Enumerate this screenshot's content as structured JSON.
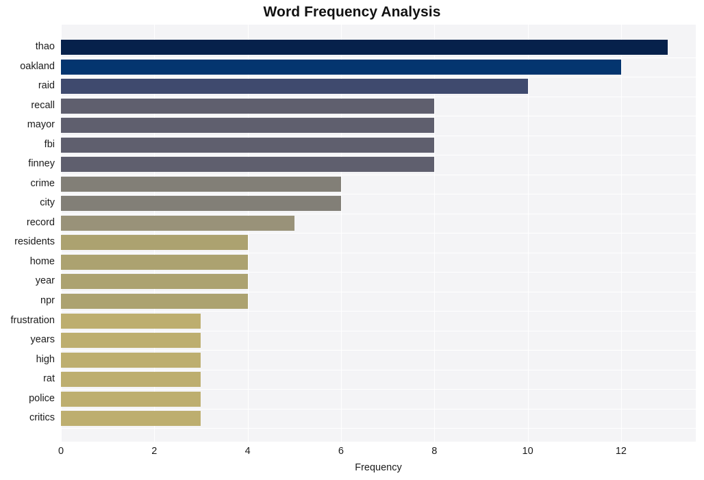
{
  "chart_data": {
    "type": "bar",
    "orientation": "horizontal",
    "title": "Word Frequency Analysis",
    "xlabel": "Frequency",
    "ylabel": "",
    "categories": [
      "thao",
      "oakland",
      "raid",
      "recall",
      "mayor",
      "fbi",
      "finney",
      "crime",
      "city",
      "record",
      "residents",
      "home",
      "year",
      "npr",
      "frustration",
      "years",
      "high",
      "rat",
      "police",
      "critics"
    ],
    "values": [
      13,
      12,
      10,
      8,
      8,
      8,
      8,
      6,
      6,
      5,
      4,
      4,
      4,
      4,
      3,
      3,
      3,
      3,
      3,
      3
    ],
    "bar_colors": [
      "#06214b",
      "#04356f",
      "#3f4a6e",
      "#5f5f6e",
      "#5f5f6e",
      "#5f5f6e",
      "#5f5f6e",
      "#827f77",
      "#827f77",
      "#999279",
      "#aca270",
      "#aca270",
      "#aca270",
      "#aca270",
      "#bdae6f",
      "#bdae6f",
      "#bdae6f",
      "#bdae6f",
      "#bdae6f",
      "#bdae6f"
    ],
    "xticks": [
      0,
      2,
      4,
      6,
      8,
      10,
      12
    ],
    "xtick_labels": [
      "0",
      "2",
      "4",
      "6",
      "8",
      "10",
      "12"
    ],
    "xlim": [
      0,
      13.6
    ],
    "grid": true,
    "grid_color": "#ffffff",
    "plot_background": "#f4f4f6",
    "figure_background": "#ffffff",
    "legend": null
  }
}
